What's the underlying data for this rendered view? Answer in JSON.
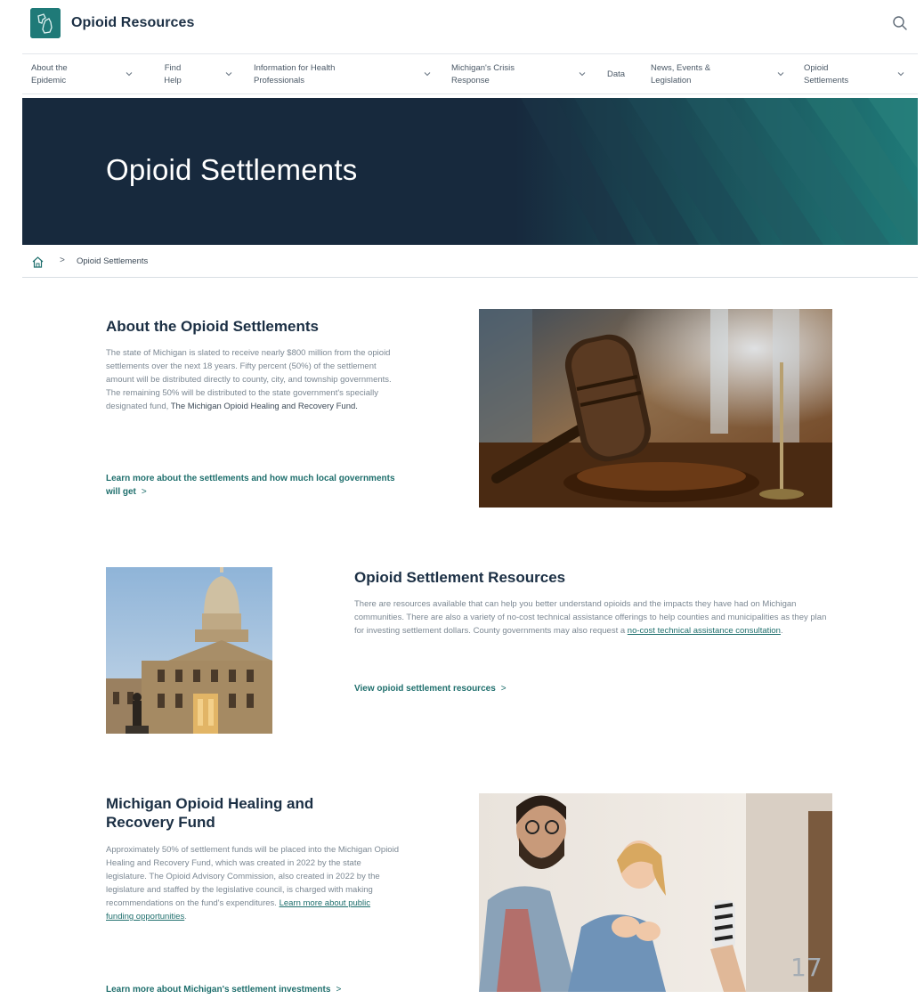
{
  "header": {
    "site_title": "Opioid Resources",
    "logo_icon": "michigan-map-logo-icon",
    "search_icon": "search-icon"
  },
  "nav": {
    "items": [
      {
        "label": "About the Epidemic"
      },
      {
        "label": "Find Help"
      },
      {
        "label": "Information for Health Professionals"
      },
      {
        "label": "Michigan's Crisis Response"
      },
      {
        "label": "Data"
      },
      {
        "label": "News, Events & Legislation"
      },
      {
        "label": "Opioid Settlements"
      }
    ]
  },
  "hero": {
    "title": "Opioid Settlements",
    "colors": {
      "background": "#17293d",
      "accent": "#1f7a78"
    }
  },
  "breadcrumb": {
    "home_icon": "home-icon",
    "separator": ">",
    "current": "Opioid Settlements"
  },
  "sections": {
    "about": {
      "heading": "About the Opioid Settlements",
      "body": "The state of Michigan is slated to receive nearly $800 million from the opioid settlements over the next 18 years. Fifty percent (50%) of the settlement amount will be distributed directly to county, city, and township governments. The remaining 50% will be distributed to the state government's specially designated fund,",
      "body_emphasis": "The Michigan Opioid Healing and Recovery Fund.",
      "cta": "Learn more about the settlements and how much local governments will get"
    },
    "resources": {
      "heading": "Opioid Settlement Resources",
      "body": "There are resources available that can help you better understand opioids and the impacts they have had on Michigan communities. There are also a variety of no-cost technical assistance offerings to help counties and municipalities as they plan for investing settlement dollars. County governments may also request a",
      "body_link": "no-cost technical assistance consultation",
      "body_end": ".",
      "cta": "View opioid settlement resources"
    },
    "fund": {
      "heading": "Michigan Opioid Healing and Recovery Fund",
      "body": "Approximately 50% of settlement funds will be placed into the Michigan Opioid Healing and Recovery Fund, which was created in 2022 by the state legislature. The Opioid Advisory Commission, also created in 2022 by the legislature and staffed by the legislative council, is charged with making recommendations on the fund's expenditures.",
      "body_link": "Learn more about public funding opportunities",
      "body_end": ".",
      "cta": "Learn more about Michigan's settlement investments"
    }
  },
  "cta_arrow": ">",
  "page_number": "17"
}
